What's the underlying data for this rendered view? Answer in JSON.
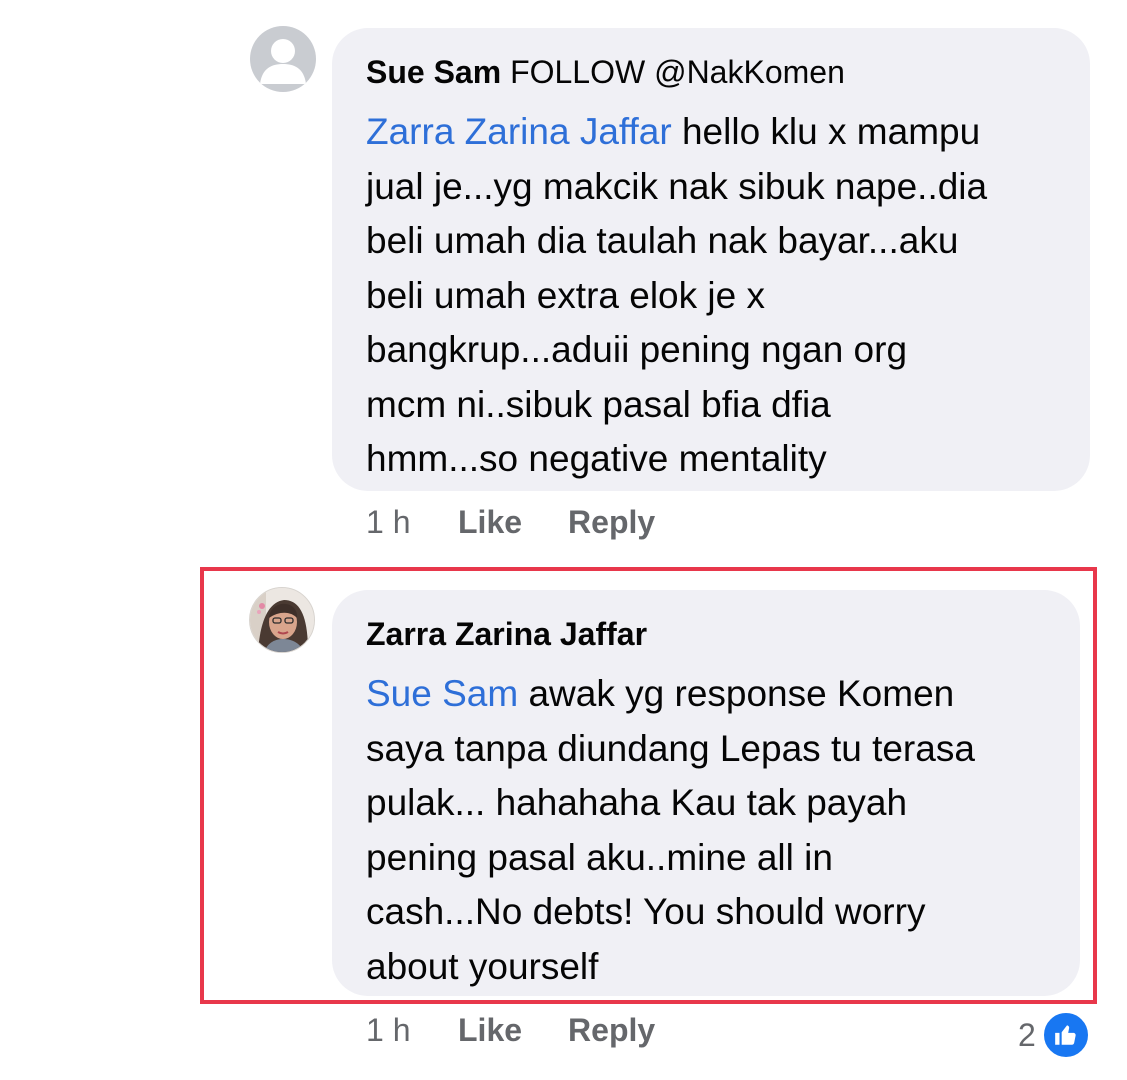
{
  "comments": [
    {
      "author": "Sue Sam",
      "author_suffix": "FOLLOW @NakKomen",
      "lines": [
        {
          "mention": "Zarra Zarina Jaffar",
          "text": " hello klu x mampu"
        },
        {
          "text": "jual je...yg makcik nak sibuk nape..dia"
        },
        {
          "text": "beli umah dia taulah nak bayar...aku"
        },
        {
          "text": "beli umah extra elok je x"
        },
        {
          "text": "bangkrup...aduii pening ngan org"
        },
        {
          "text": "mcm ni..sibuk pasal bfia dfia"
        },
        {
          "text": "hmm...so negative mentality"
        }
      ],
      "time": "1 h",
      "like_label": "Like",
      "reply_label": "Reply",
      "avatar_icon": "default-profile-icon"
    },
    {
      "author": "Zarra Zarina Jaffar",
      "lines": [
        {
          "mention": "Sue Sam",
          "text": " awak yg response Komen"
        },
        {
          "text": "saya tanpa diundang Lepas tu terasa"
        },
        {
          "text": "pulak... hahahaha Kau tak payah"
        },
        {
          "text": "pening pasal aku..mine all in"
        },
        {
          "text": "cash...No debts! You should worry"
        },
        {
          "text": "about yourself"
        }
      ],
      "time": "1 h",
      "like_label": "Like",
      "reply_label": "Reply",
      "reaction_count": "2",
      "reaction_icon": "thumbs-up-icon",
      "avatar_icon": "profile-photo"
    }
  ],
  "colors": {
    "mention": "#2e6fd8",
    "bubble": "#f0f0f5",
    "highlight_border": "#e8374b",
    "like_badge": "#1877f2"
  }
}
